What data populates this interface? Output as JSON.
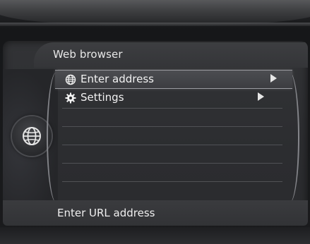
{
  "header": {
    "title": "Web browser"
  },
  "menu": {
    "items": [
      {
        "label": "Enter address",
        "icon": "globe-icon",
        "selected": true
      },
      {
        "label": "Settings",
        "icon": "gear-icon",
        "selected": false
      }
    ]
  },
  "side": {
    "icon": "globe-icon"
  },
  "status": {
    "text": "Enter URL address"
  },
  "colors": {
    "text": "#f2f2f2",
    "highlight_border": "#9a9ba0",
    "background": "#2c2d30"
  }
}
